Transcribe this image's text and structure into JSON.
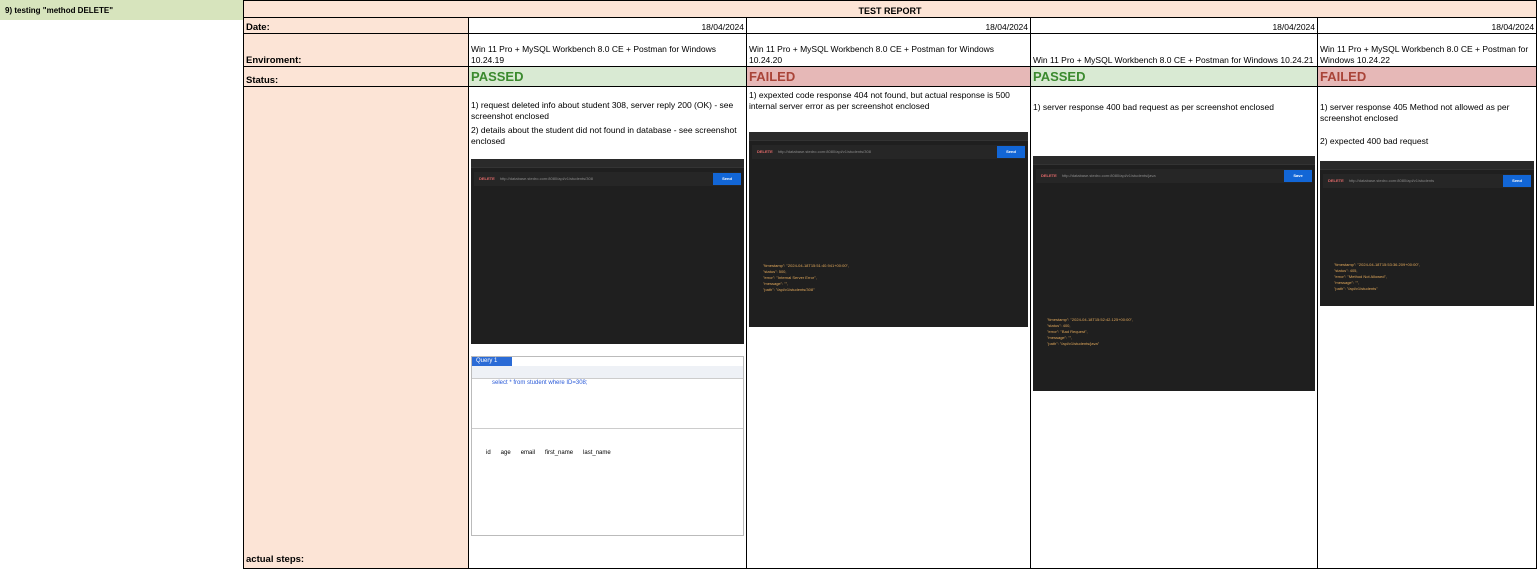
{
  "sheet": {
    "title": "9) testing \"method DELETE\""
  },
  "report": {
    "heading": "TEST REPORT",
    "labels": {
      "date": "Date:",
      "environment": "Enviroment:",
      "status": "Status:",
      "steps": "actual steps:"
    },
    "columns": [
      {
        "date": "18/04/2024",
        "environment": "Win 11 Pro + MySQL Workbench 8.0 CE + Postman for Windows 10.24.19",
        "status": "PASSED",
        "notes": [
          "1) request deleted info about student 308, server reply 200 (OK)  - see screenshot enclosed",
          "2) details about the student did not found in database - see screenshot enclosed"
        ],
        "shot": {
          "method": "DELETE",
          "url": "http://database.stedro.com:8080/api/v1/students/308",
          "send": "Send",
          "json": []
        },
        "query": {
          "tab": "Query 1",
          "sql": "select * from student where ID=308;",
          "columns": [
            "id",
            "age",
            "email",
            "first_name",
            "last_name"
          ]
        }
      },
      {
        "date": "18/04/2024",
        "environment": "Win 11 Pro + MySQL Workbench 8.0 CE + Postman for Windows 10.24.20",
        "status": "FAILED",
        "notes": [
          "1) expexted code response 404 not found, but actual response is 500 internal server error as per screenshot enclosed"
        ],
        "shot": {
          "method": "DELETE",
          "url": "http://database.stedro.com:8080/api/v1/students/308",
          "send": "Send",
          "json": [
            "\"timestamp\": \"2024-04-18T15:51:40.941+00:00\",",
            "\"status\": 500,",
            "\"error\": \"Internal Server Error\",",
            "\"message\": \"\",",
            "\"path\": \"/api/v1/students/308\""
          ]
        }
      },
      {
        "date": "18/04/2024",
        "environment": "Win 11 Pro + MySQL Workbench 8.0 CE + Postman for Windows 10.24.21",
        "status": "PASSED",
        "notes": [
          "1) server response 400 bad request as per screenshot enclosed"
        ],
        "shot": {
          "method": "DELETE",
          "url": "http://database.stedro.com:8080/api/v1/students/java",
          "send": "Save",
          "json": [
            "\"timestamp\": \"2024-04-18T15:52:42.125+00:00\",",
            "\"status\": 400,",
            "\"error\": \"Bad Request\",",
            "\"message\": \"\",",
            "\"path\": \"/api/v1/students/java\""
          ]
        }
      },
      {
        "date": "18/04/2024",
        "environment": "Win 11 Pro + MySQL Workbench 8.0 CE + Postman for Windows 10.24.22",
        "status": "FAILED",
        "notes": [
          "1) server response 405 Method not allowed as per screenshot enclosed",
          "2) expected 400 bad request"
        ],
        "shot": {
          "method": "DELETE",
          "url": "http://database.stedro.com:8080/api/v1/students",
          "send": "Send",
          "json": [
            "\"timestamp\": \"2024-04-18T15:53:36.209+00:00\",",
            "\"status\": 405,",
            "\"error\": \"Method Not Allowed\",",
            "\"message\": \"\",",
            "\"path\": \"/api/v1/students\""
          ]
        }
      }
    ]
  }
}
